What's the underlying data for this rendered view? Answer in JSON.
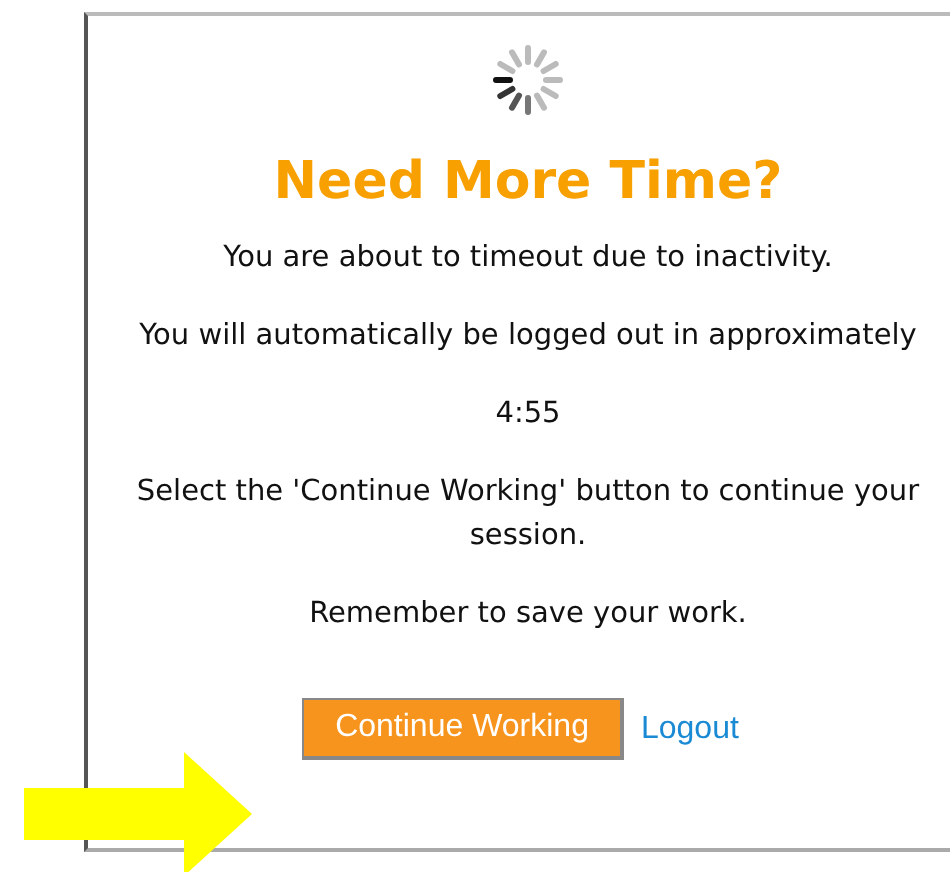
{
  "dialog": {
    "title": "Need More Time?",
    "paragraphs": [
      "You are about to timeout due to inactivity.",
      "You will automatically be logged out in approximately",
      "4:55",
      "Select the 'Continue Working' button to continue your session.",
      "Remember to save your work."
    ],
    "actions": [
      {
        "kind": "button",
        "label": "Continue Working"
      },
      {
        "kind": "link",
        "label": "Logout"
      }
    ]
  }
}
